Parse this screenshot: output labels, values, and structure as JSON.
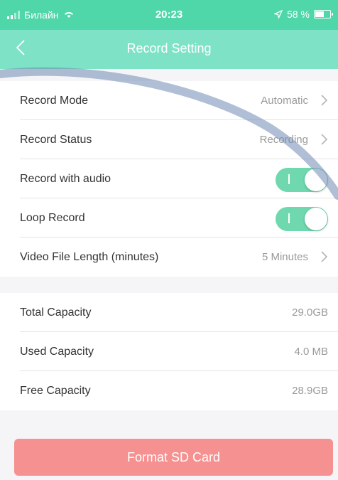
{
  "status_bar": {
    "carrier": "Билайн",
    "time": "20:23",
    "battery": "58 %",
    "battery_level": 0.58,
    "icons": [
      "signal-icon",
      "wifi-icon",
      "location-arrow-icon",
      "battery-icon"
    ]
  },
  "nav": {
    "title": "Record Setting",
    "back_icon": "chevron-left-icon"
  },
  "record_settings": [
    {
      "label": "Record Mode",
      "value": "Automatic",
      "type": "link"
    },
    {
      "label": "Record Status",
      "value": "Recording",
      "type": "link"
    },
    {
      "label": "Record with audio",
      "type": "toggle",
      "on": true
    },
    {
      "label": "Loop Record",
      "type": "toggle",
      "on": true
    },
    {
      "label": "Video File Length (minutes)",
      "value": "5 Minutes",
      "type": "link"
    }
  ],
  "capacity": [
    {
      "label": "Total Capacity",
      "value": "29.0GB"
    },
    {
      "label": "Used Capacity",
      "value": "4.0 MB"
    },
    {
      "label": "Free Capacity",
      "value": "28.9GB"
    }
  ],
  "format_button": {
    "label": "Format SD Card"
  },
  "colors": {
    "status_bar": "#4fd6a9",
    "nav_bar": "#7ee3c6",
    "toggle_on": "#6fd8ae",
    "format_button": "#f59190",
    "value_text": "#9a9a9a"
  }
}
